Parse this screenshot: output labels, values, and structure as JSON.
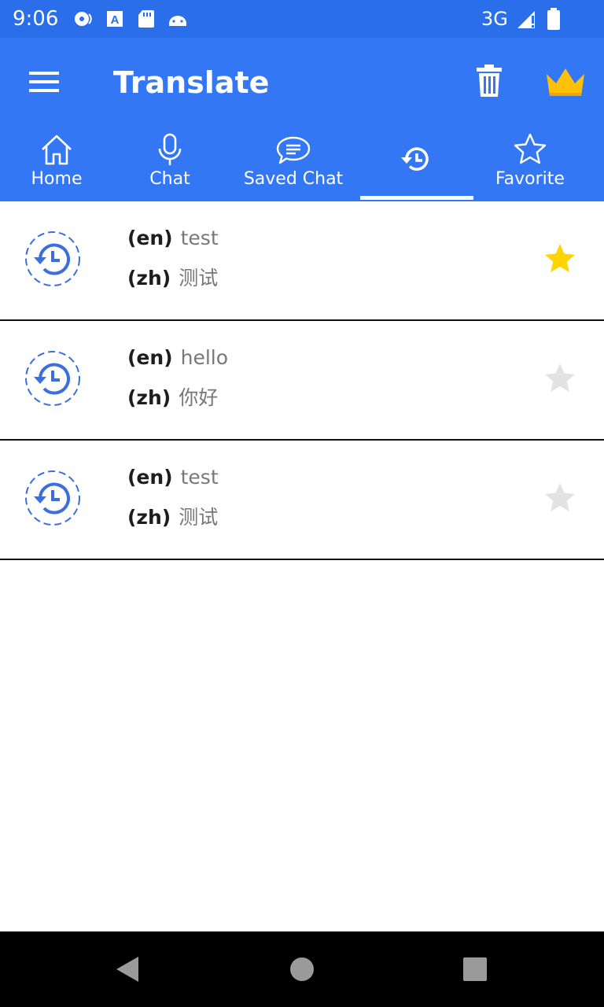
{
  "status_bar": {
    "time": "9:06",
    "network": "3G",
    "icons": [
      "podcast-icon",
      "font-a-icon",
      "sd-card-icon",
      "android-icon",
      "signal-icon",
      "battery-icon"
    ]
  },
  "app_bar": {
    "title": "Translate",
    "icons": [
      "menu-icon",
      "trash-icon",
      "crown-icon"
    ],
    "colors": {
      "background": "#3477f5",
      "crown": "#ffc107"
    }
  },
  "tabs": [
    {
      "label": "Home",
      "icon": "home-icon"
    },
    {
      "label": "Chat",
      "icon": "microphone-icon"
    },
    {
      "label": "Saved Chat",
      "icon": "chat-bubble-icon"
    },
    {
      "label": "",
      "icon": "history-icon",
      "selected": true
    },
    {
      "label": "Favorite",
      "icon": "star-outline-icon"
    }
  ],
  "history": [
    {
      "src_lang": "(en)",
      "src_text": "test",
      "dst_lang": "(zh)",
      "dst_text": "测试",
      "favorite": true
    },
    {
      "src_lang": "(en)",
      "src_text": "hello",
      "dst_lang": "(zh)",
      "dst_text": "你好",
      "favorite": false
    },
    {
      "src_lang": "(en)",
      "src_text": "test",
      "dst_lang": "(zh)",
      "dst_text": "测试",
      "favorite": false
    }
  ],
  "colors": {
    "star_active": "#ffd400",
    "star_inactive": "#e2e2e2",
    "history_icon": "#3a6fe0"
  },
  "nav_bar": {
    "icons": [
      "back-icon",
      "home-circle-icon",
      "recents-icon"
    ]
  }
}
